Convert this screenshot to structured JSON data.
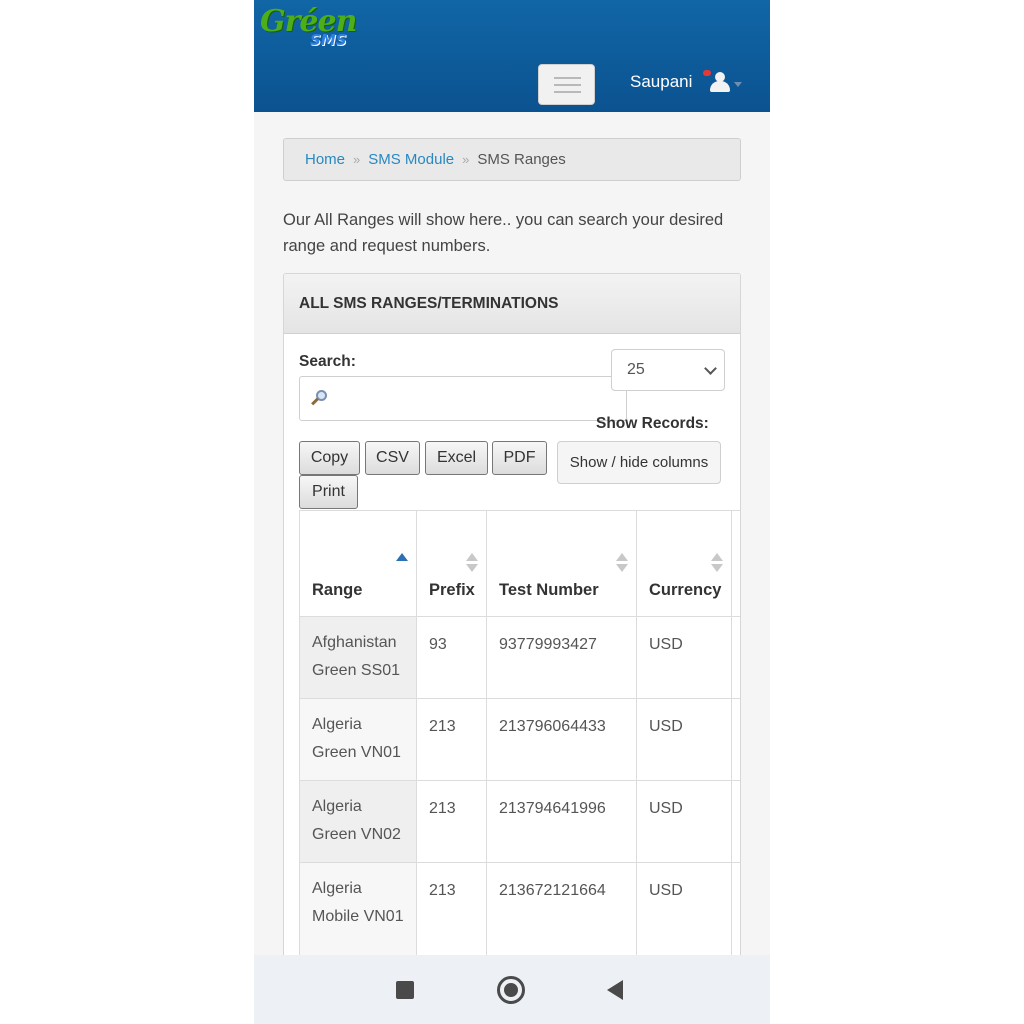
{
  "header": {
    "logo_main": "Gréen",
    "logo_sub": "SMS",
    "username": "Saupani"
  },
  "breadcrumb": {
    "home": "Home",
    "module": "SMS Module",
    "current": "SMS Ranges",
    "separator": "»"
  },
  "intro_text": "Our All Ranges will show here.. you can search your desired range and request numbers.",
  "panel": {
    "title": "ALL SMS RANGES/TERMINATIONS",
    "search_label": "Search:",
    "search_value": "",
    "records_value": "25",
    "show_records_label": "Show Records:",
    "buttons": {
      "copy": "Copy",
      "csv": "CSV",
      "excel": "Excel",
      "pdf": "PDF",
      "print": "Print",
      "columns": "Show / hide columns"
    }
  },
  "table": {
    "columns": [
      "Range",
      "Prefix",
      "Test Number",
      "Currency"
    ],
    "rows": [
      {
        "range": "Afghanistan Green SS01",
        "prefix": "93",
        "test_number": "93779993427",
        "currency": "USD"
      },
      {
        "range": "Algeria Green VN01",
        "prefix": "213",
        "test_number": "213796064433",
        "currency": "USD"
      },
      {
        "range": "Algeria Green VN02",
        "prefix": "213",
        "test_number": "213794641996",
        "currency": "USD"
      },
      {
        "range": "Algeria Mobile VN01",
        "prefix": "213",
        "test_number": "213672121664",
        "currency": "USD"
      }
    ]
  },
  "colors": {
    "header_bg": "#0b5290",
    "link": "#2a88c0",
    "sort_active": "#2d6fb5"
  }
}
